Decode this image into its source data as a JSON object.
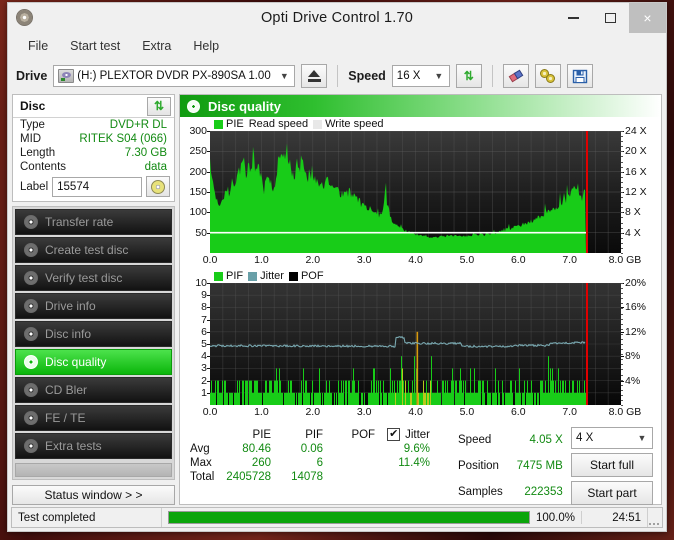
{
  "window": {
    "title": "Opti Drive Control 1.70",
    "icon": "disc-icon",
    "minimize": "minimize-icon",
    "maximize": "maximize-icon",
    "close": "×"
  },
  "menu": {
    "items": [
      "File",
      "Start test",
      "Extra",
      "Help"
    ]
  },
  "toolbar": {
    "drive_label": "Drive",
    "drive_value": "(H:)   PLEXTOR DVDR   PX-890SA 1.00",
    "eject_label": "eject-icon",
    "speed_label": "Speed",
    "speed_value": "16 X",
    "refresh_icon": "refresh-arrows-icon",
    "erase_icon": "eraser-icon",
    "tools_icon": "wrench-icon",
    "save_icon": "floppy-save-icon"
  },
  "disc": {
    "header": "Disc",
    "refresh_icon": "refresh-arrows-icon",
    "rows": [
      {
        "key": "Type",
        "value": "DVD+R DL"
      },
      {
        "key": "MID",
        "value": "RITEK S04 (066)"
      },
      {
        "key": "Length",
        "value": "7.30 GB"
      },
      {
        "key": "Contents",
        "value": "data"
      }
    ],
    "label_key": "Label",
    "label_value": "15574",
    "label_placeholder": "",
    "disc_button_icon": "cd-disc-icon"
  },
  "nav": {
    "items": [
      {
        "label": "Transfer rate",
        "active": false
      },
      {
        "label": "Create test disc",
        "active": false
      },
      {
        "label": "Verify test disc",
        "active": false
      },
      {
        "label": "Drive info",
        "active": false
      },
      {
        "label": "Disc info",
        "active": false
      },
      {
        "label": "Disc quality",
        "active": true
      },
      {
        "label": "CD Bler",
        "active": false
      },
      {
        "label": "FE / TE",
        "active": false
      },
      {
        "label": "Extra tests",
        "active": false
      }
    ],
    "status_window": "Status window > >"
  },
  "panel": {
    "header": "Disc quality",
    "header_icon": "disc-quality-icon"
  },
  "chart_data": [
    {
      "id": "pie-chart",
      "type": "area",
      "title": "PIE",
      "legend": [
        {
          "label": "PIE",
          "color": "#18cc18"
        },
        {
          "label": "Read speed",
          "color": "#ffffff"
        },
        {
          "label": "Write speed",
          "color": "#e8e8e8"
        }
      ],
      "legend_position": "top-left",
      "grid": true,
      "xlabel": "GB",
      "xlim": [
        0.0,
        8.0
      ],
      "xticks": [
        "0.0",
        "1.0",
        "2.0",
        "3.0",
        "4.0",
        "5.0",
        "6.0",
        "7.0",
        "8.0 GB"
      ],
      "ylabel": "",
      "ylim": [
        0,
        300
      ],
      "yticks": [
        50,
        100,
        150,
        200,
        250,
        300
      ],
      "y2label": "X",
      "y2lim": [
        0,
        24
      ],
      "y2ticks": [
        "4 X",
        "8 X",
        "12 X",
        "16 X",
        "20 X",
        "24 X"
      ],
      "data_end_x": 7.32,
      "marker_x": 7.32,
      "marker_color": "#e00000",
      "read_speed_value": 4.05,
      "series": [
        {
          "name": "PIE",
          "color": "#18cc18",
          "x": [
            0.0,
            0.05,
            0.1,
            0.15,
            0.2,
            0.25,
            0.3,
            0.35,
            0.4,
            0.45,
            0.5,
            0.55,
            0.6,
            0.65,
            0.7,
            0.75,
            0.8,
            0.85,
            0.9,
            0.95,
            1.0,
            1.05,
            1.1,
            1.15,
            1.2,
            1.25,
            1.3,
            1.35,
            1.4,
            1.45,
            1.5,
            1.55,
            1.6,
            1.65,
            1.7,
            1.75,
            1.8,
            1.85,
            1.9,
            1.95,
            2.0,
            2.05,
            2.1,
            2.15,
            2.2,
            2.25,
            2.3,
            2.35,
            2.4,
            2.45,
            2.5,
            2.55,
            2.6,
            2.65,
            2.7,
            2.75,
            2.8,
            2.85,
            2.9,
            2.95,
            3.0,
            3.05,
            3.1,
            3.15,
            3.2,
            3.25,
            3.3,
            3.35,
            3.4,
            3.45,
            3.5,
            3.55,
            3.6,
            3.65,
            3.7,
            3.75,
            3.8,
            3.85,
            3.9,
            3.95,
            4.0,
            4.1,
            4.2,
            4.3,
            4.4,
            4.5,
            4.6,
            4.7,
            4.8,
            4.9,
            5.0,
            5.1,
            5.2,
            5.3,
            5.4,
            5.5,
            5.6,
            5.7,
            5.8,
            5.9,
            6.0,
            6.1,
            6.2,
            6.3,
            6.4,
            6.5,
            6.6,
            6.7,
            6.8,
            6.9,
            7.0,
            7.05,
            7.1,
            7.15,
            7.2,
            7.25,
            7.3,
            7.32
          ],
          "y": [
            220,
            175,
            140,
            120,
            108,
            128,
            150,
            138,
            160,
            178,
            168,
            192,
            205,
            245,
            182,
            210,
            196,
            230,
            200,
            215,
            178,
            152,
            196,
            175,
            168,
            150,
            205,
            235,
            258,
            230,
            250,
            222,
            200,
            186,
            230,
            210,
            238,
            205,
            185,
            200,
            178,
            175,
            165,
            170,
            158,
            182,
            172,
            160,
            150,
            155,
            148,
            140,
            145,
            138,
            152,
            144,
            138,
            132,
            126,
            120,
            118,
            110,
            112,
            105,
            100,
            96,
            92,
            90,
            150,
            120,
            96,
            78,
            70,
            66,
            62,
            58,
            55,
            52,
            50,
            48,
            46,
            44,
            42,
            40,
            38,
            40,
            42,
            44,
            42,
            40,
            42,
            44,
            46,
            44,
            46,
            48,
            50,
            54,
            58,
            62,
            66,
            70,
            74,
            80,
            86,
            92,
            100,
            108,
            116,
            126,
            140,
            152,
            163,
            158,
            140,
            132,
            160,
            165
          ]
        },
        {
          "name": "Read speed",
          "color": "#ffffff",
          "constant_y": 50
        }
      ]
    },
    {
      "id": "pif-chart",
      "type": "bar",
      "title": "PIF",
      "legend": [
        {
          "label": "PIF",
          "color": "#18cc18"
        },
        {
          "label": "Jitter",
          "color": "#69a0a8"
        },
        {
          "label": "POF",
          "color": "#000000"
        }
      ],
      "legend_position": "top-left",
      "grid": true,
      "xlabel": "GB",
      "xlim": [
        0.0,
        8.0
      ],
      "xticks": [
        "0.0",
        "1.0",
        "2.0",
        "3.0",
        "4.0",
        "5.0",
        "6.0",
        "7.0",
        "8.0 GB"
      ],
      "ylim": [
        0,
        10
      ],
      "yticks": [
        1,
        2,
        3,
        4,
        5,
        6,
        7,
        8,
        9,
        10
      ],
      "y2lim": [
        0,
        20
      ],
      "y2ticks": [
        "4%",
        "8%",
        "12%",
        "16%",
        "20%"
      ],
      "data_end_x": 7.32,
      "marker_x": 7.32,
      "marker_color": "#e00000",
      "jitter_series": {
        "name": "Jitter",
        "color": "#69a0a8",
        "avg_percent": 9.6,
        "max_percent": 11.4
      }
    }
  ],
  "stats": {
    "columns": [
      "PIE",
      "PIF",
      "POF",
      "Jitter"
    ],
    "jitter_checked": true,
    "rows": [
      {
        "label": "Avg",
        "pie": "80.46",
        "pif": "0.06",
        "pof": "",
        "jitter": "9.6%"
      },
      {
        "label": "Max",
        "pie": "260",
        "pif": "6",
        "pof": "",
        "jitter": "11.4%"
      },
      {
        "label": "Total",
        "pie": "2405728",
        "pif": "14078",
        "pof": "",
        "jitter": ""
      }
    ]
  },
  "readout": {
    "speed_key": "Speed",
    "speed_value": "4.05 X",
    "position_key": "Position",
    "position_value": "7475 MB",
    "samples_key": "Samples",
    "samples_value": "222353"
  },
  "actions": {
    "speed_select": "4 X",
    "start_full": "Start full",
    "start_part": "Start part"
  },
  "statusbar": {
    "text": "Test completed",
    "percent": "100.0%",
    "progress": 100,
    "time": "24:51"
  }
}
